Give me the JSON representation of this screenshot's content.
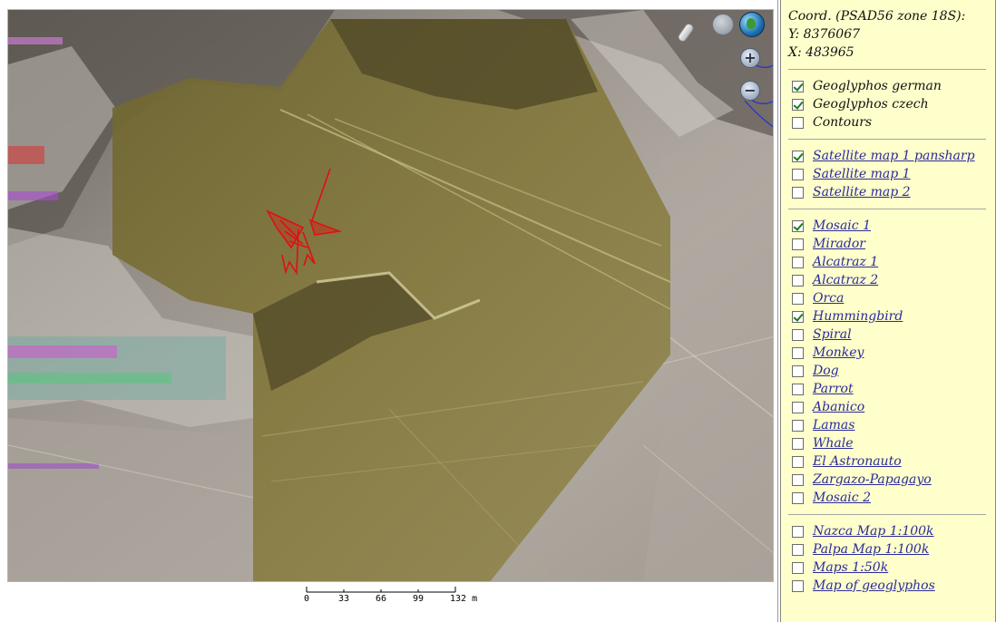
{
  "coords": {
    "system_label": "Coord. (PSAD56 zone 18S):",
    "y_text": "Y: 8376067",
    "x_text": "X: 483965"
  },
  "layer_groups": [
    {
      "group": "geoglyphs",
      "items": [
        {
          "label": "Geoglyphos german",
          "checked": true,
          "link": false
        },
        {
          "label": "Geoglyphos czech",
          "checked": true,
          "link": false
        },
        {
          "label": "Contours",
          "checked": false,
          "link": false
        }
      ]
    },
    {
      "group": "satellite",
      "items": [
        {
          "label": "Satellite map 1 pansharp",
          "checked": true,
          "link": true
        },
        {
          "label": "Satellite map 1",
          "checked": false,
          "link": true
        },
        {
          "label": "Satellite map 2",
          "checked": false,
          "link": true
        }
      ]
    },
    {
      "group": "mosaics",
      "items": [
        {
          "label": "Mosaic 1",
          "checked": true,
          "link": true
        },
        {
          "label": "Mirador",
          "checked": false,
          "link": true
        },
        {
          "label": "Alcatraz 1",
          "checked": false,
          "link": true
        },
        {
          "label": "Alcatraz 2",
          "checked": false,
          "link": true
        },
        {
          "label": "Orca",
          "checked": false,
          "link": true
        },
        {
          "label": "Hummingbird",
          "checked": true,
          "link": true
        },
        {
          "label": "Spiral",
          "checked": false,
          "link": true
        },
        {
          "label": "Monkey",
          "checked": false,
          "link": true
        },
        {
          "label": "Dog",
          "checked": false,
          "link": true
        },
        {
          "label": "Parrot",
          "checked": false,
          "link": true
        },
        {
          "label": "Abanico",
          "checked": false,
          "link": true
        },
        {
          "label": "Lamas",
          "checked": false,
          "link": true
        },
        {
          "label": "Whale",
          "checked": false,
          "link": true
        },
        {
          "label": "El Astronauto",
          "checked": false,
          "link": true
        },
        {
          "label": "Zargazo-Papagayo",
          "checked": false,
          "link": true
        },
        {
          "label": "Mosaic 2",
          "checked": false,
          "link": true
        }
      ]
    },
    {
      "group": "maps",
      "items": [
        {
          "label": "Nazca Map 1:100k",
          "checked": false,
          "link": true
        },
        {
          "label": "Palpa Map 1:100k",
          "checked": false,
          "link": true
        },
        {
          "label": "Maps 1:50k",
          "checked": false,
          "link": true
        },
        {
          "label": "Map of geoglyphos",
          "checked": false,
          "link": true
        }
      ]
    }
  ],
  "map": {
    "zoom_in_symbol": "+",
    "zoom_out_symbol": "−",
    "scale": {
      "ticks": [
        "0",
        "33",
        "66",
        "99",
        "132 m"
      ]
    }
  },
  "colors": {
    "panel_bg": "#ffffcc",
    "link": "#2b2b9a",
    "overlay": "#7d7437",
    "geoglyph_red": "#e01010",
    "contour_blue": "#2233cc"
  },
  "icons": {
    "pan": "pan-icon",
    "globe": "globe-icon",
    "drag": "drag-handle-icon",
    "zoom_in": "zoom-in-icon",
    "zoom_out": "zoom-out-icon",
    "checkbox": "checkbox-icon"
  }
}
